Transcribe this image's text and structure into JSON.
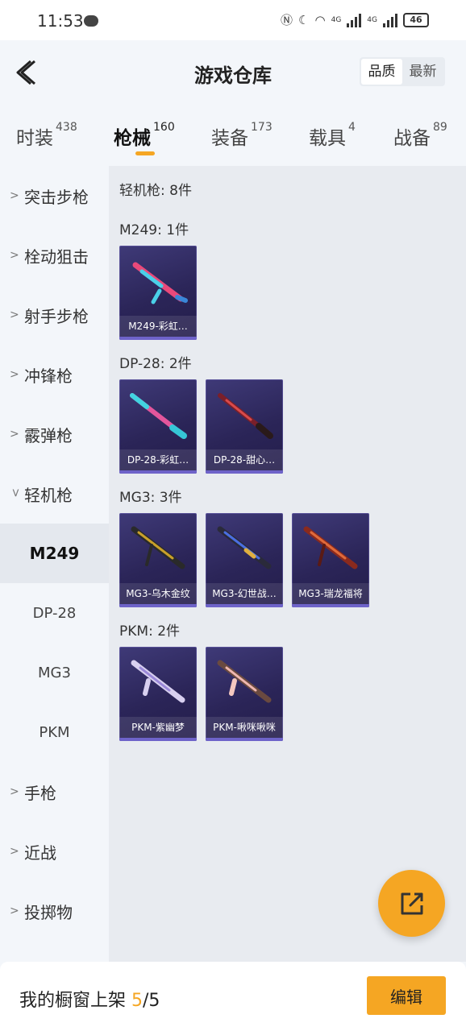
{
  "status": {
    "time": "11:53",
    "net1": "4G",
    "net2": "4G",
    "battery": "46"
  },
  "header": {
    "title": "游戏仓库",
    "sort_options": [
      "品质",
      "最新"
    ]
  },
  "tabs": [
    {
      "label": "时装",
      "count": "438"
    },
    {
      "label": "枪械",
      "count": "160"
    },
    {
      "label": "装备",
      "count": "173"
    },
    {
      "label": "载具",
      "count": "4"
    },
    {
      "label": "战备",
      "count": "89"
    }
  ],
  "sidebar": {
    "categories": [
      "突击步枪",
      "栓动狙击",
      "射手步枪",
      "冲锋枪",
      "霰弹枪",
      "轻机枪"
    ],
    "sub_items": [
      "M249",
      "DP-28",
      "MG3",
      "PKM"
    ],
    "bottom_categories": [
      "手枪",
      "近战",
      "投掷物"
    ]
  },
  "content": {
    "category_heading": "轻机枪: 8件",
    "groups": [
      {
        "title": "M249: 1件",
        "items": [
          "M249-彩虹…"
        ]
      },
      {
        "title": "DP-28: 2件",
        "items": [
          "DP-28-彩虹…",
          "DP-28-甜心…"
        ]
      },
      {
        "title": "MG3: 3件",
        "items": [
          "MG3-乌木金纹",
          "MG3-幻世战…",
          "MG3-瑞龙福将"
        ]
      },
      {
        "title": "PKM: 2件",
        "items": [
          "PKM-紫幽梦",
          "PKM-啾咪啾咪"
        ]
      }
    ]
  },
  "bottom": {
    "shelf_label": "我的橱窗上架",
    "shelf_current": "5",
    "shelf_total": "/5",
    "edit_label": "编辑"
  },
  "colors": {
    "accent": "#f5a623",
    "card_bg": "#2b2558"
  }
}
